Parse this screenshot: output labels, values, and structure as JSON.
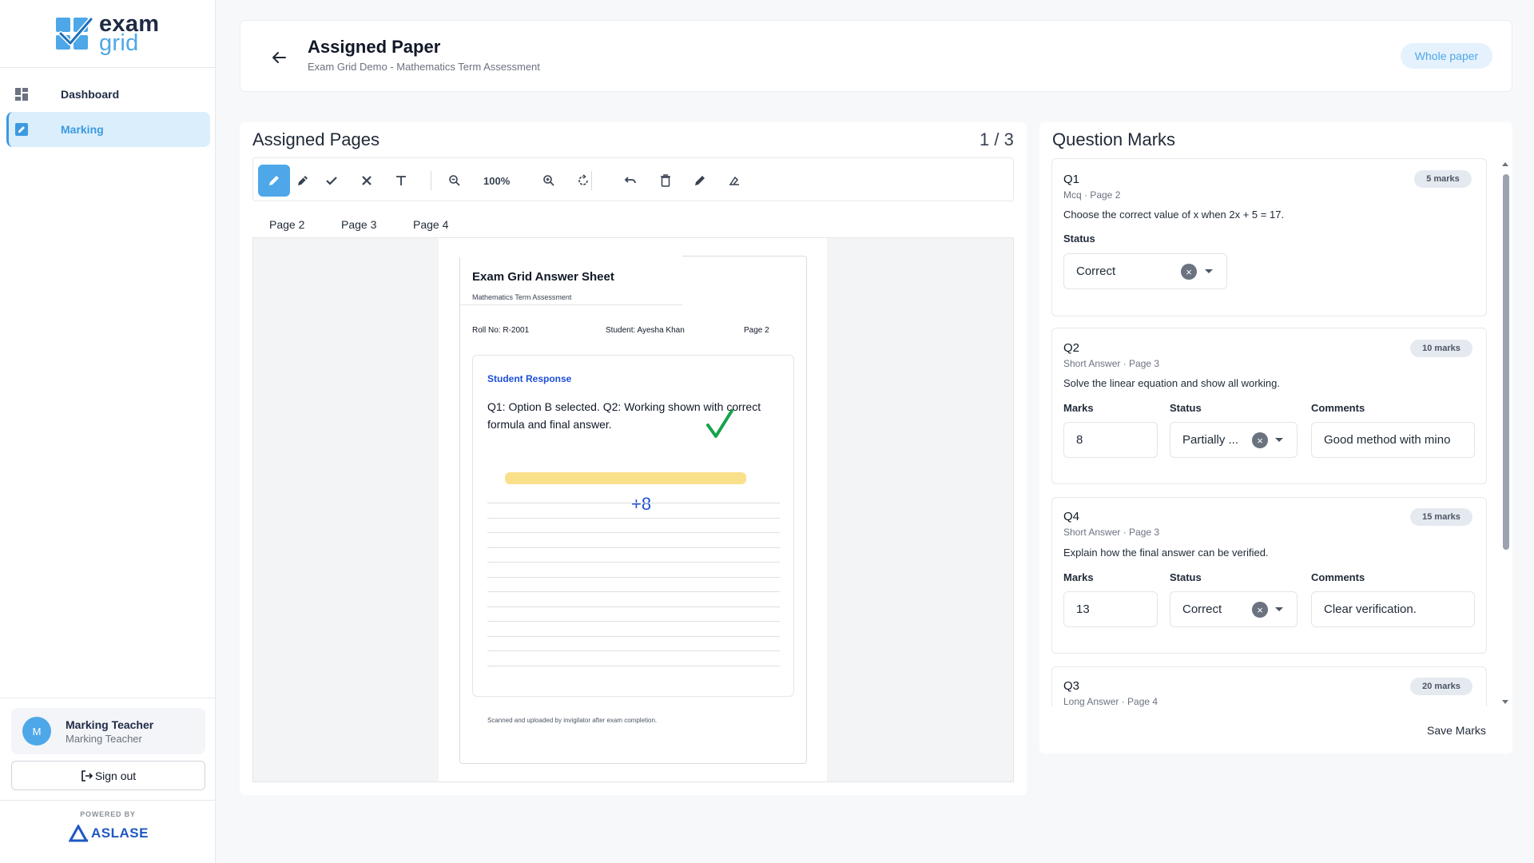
{
  "brand": {
    "line1": "exam",
    "line2": "grid"
  },
  "sidebar": {
    "items": [
      {
        "label": "Dashboard",
        "icon": "dashboard-icon"
      },
      {
        "label": "Marking",
        "icon": "edit-square-icon"
      }
    ],
    "user": {
      "initial": "M",
      "name": "Marking Teacher",
      "role": "Marking Teacher"
    },
    "signout_label": "Sign out",
    "powered_by": "POWERED BY",
    "company": "ASLASE"
  },
  "header": {
    "title": "Assigned Paper",
    "subtitle": "Exam Grid Demo - Mathematics Term Assessment",
    "whole_paper": "Whole paper"
  },
  "viewer": {
    "title": "Assigned Pages",
    "page_count": "1 / 3",
    "zoom": "100%",
    "tabs": [
      "Page 2",
      "Page 3",
      "Page 4"
    ]
  },
  "sheet": {
    "title": "Exam Grid Answer Sheet",
    "subtitle": "Mathematics Term Assessment",
    "roll": "Roll No: R-2001",
    "student": "Student: Ayesha Khan",
    "page": "Page 2",
    "response_label": "Student Response",
    "response_text": "Q1: Option B selected. Q2: Working shown with correct formula and final answer.",
    "mark_annotation": "+8",
    "footer": "Scanned and uploaded by invigilator after exam completion."
  },
  "marks": {
    "title": "Question Marks",
    "labels": {
      "marks": "Marks",
      "status": "Status",
      "comments": "Comments"
    },
    "questions": [
      {
        "id": "Q1",
        "meta": "Mcq · Page 2",
        "text": "Choose the correct value of x when 2x + 5 = 17.",
        "badge": "5 marks",
        "status": "Correct"
      },
      {
        "id": "Q2",
        "meta": "Short Answer · Page 3",
        "text": "Solve the linear equation and show all working.",
        "badge": "10 marks",
        "marks": "8",
        "status": "Partially ...",
        "comment": "Good method with mino"
      },
      {
        "id": "Q4",
        "meta": "Short Answer · Page 3",
        "text": "Explain how the final answer can be verified.",
        "badge": "15 marks",
        "marks": "13",
        "status": "Correct",
        "comment": "Clear verification."
      },
      {
        "id": "Q3",
        "meta": "Long Answer · Page 4",
        "badge": "20 marks"
      }
    ],
    "save_label": "Save Marks"
  },
  "colors": {
    "accent": "#4ea7e8",
    "check": "#16a34a",
    "annotation": "#1d4ed8",
    "highlight": "#fbe08c"
  }
}
